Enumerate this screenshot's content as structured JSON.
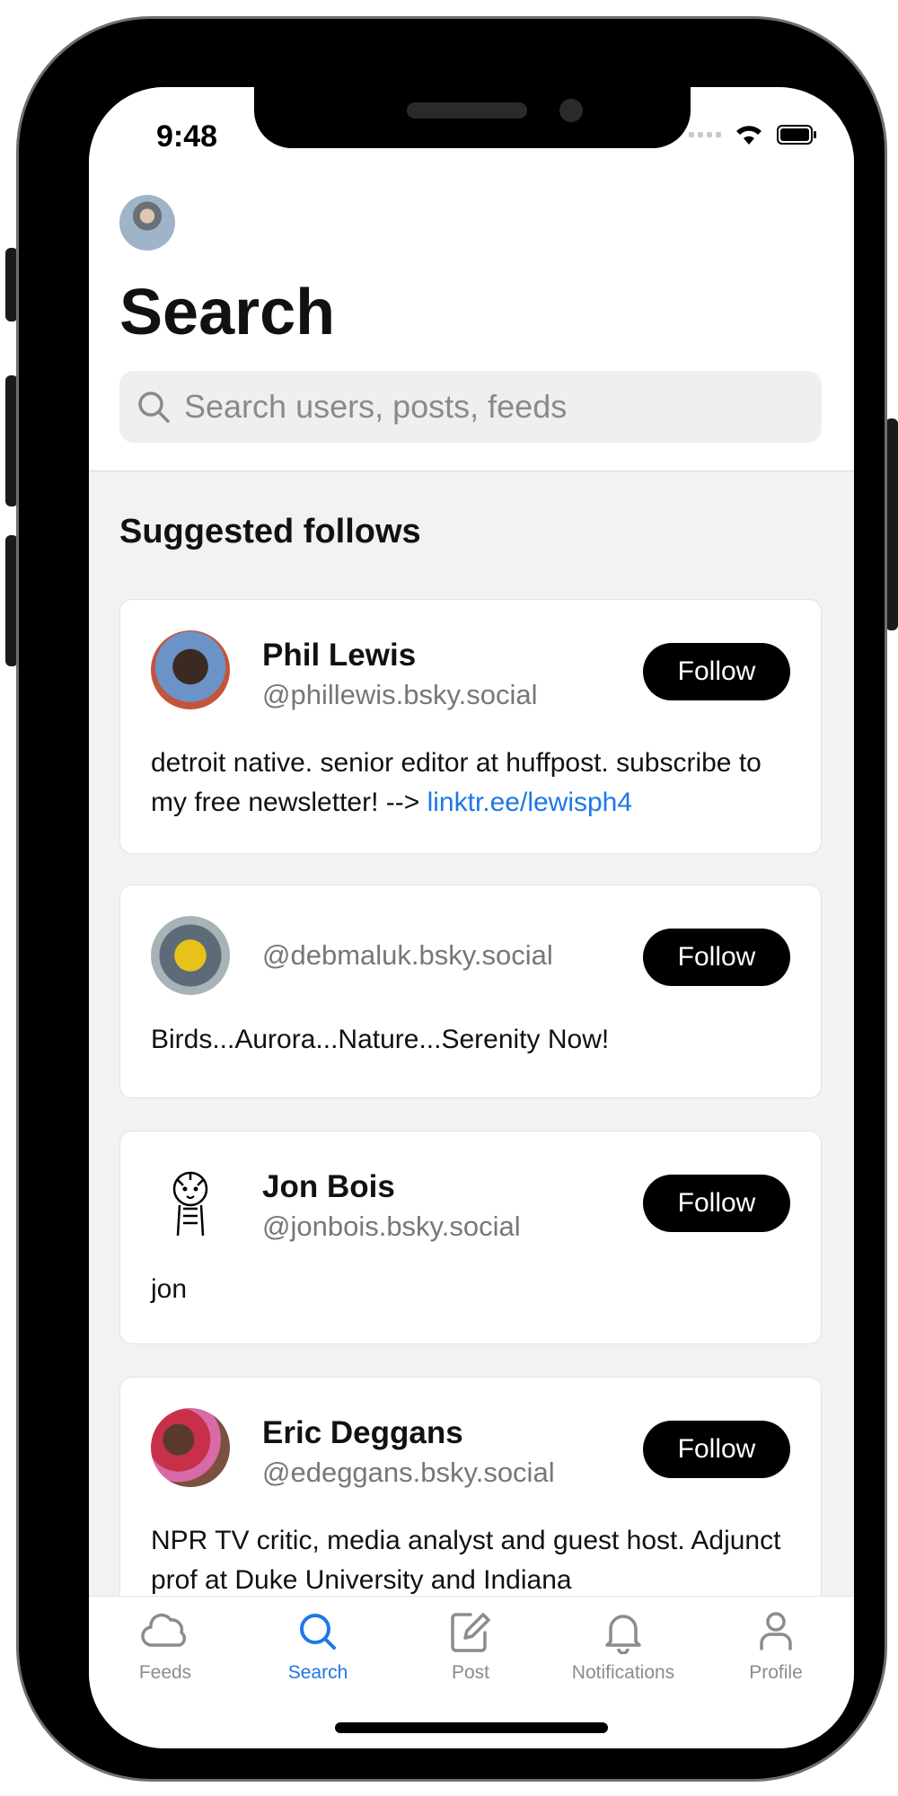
{
  "status": {
    "time": "9:48"
  },
  "header": {
    "title": "Search",
    "search_placeholder": "Search users, posts, feeds"
  },
  "section": {
    "title": "Suggested follows"
  },
  "suggestions": [
    {
      "name": "Phil Lewis",
      "handle": "@phillewis.bsky.social",
      "bio_text": "detroit native. senior editor at huffpost. subscribe to my free newsletter! --> ",
      "bio_link": "linktr.ee/lewisph4",
      "follow_label": "Follow"
    },
    {
      "name": "",
      "handle": "@debmaluk.bsky.social",
      "bio_text": "Birds...Aurora...Nature...Serenity Now!",
      "follow_label": "Follow"
    },
    {
      "name": "Jon Bois",
      "handle": "@jonbois.bsky.social",
      "bio_text": "jon",
      "follow_label": "Follow"
    },
    {
      "name": "Eric Deggans",
      "handle": "@edeggans.bsky.social",
      "bio_text": "NPR TV critic, media analyst and guest host. Adjunct prof at Duke University and Indiana",
      "follow_label": "Follow"
    }
  ],
  "tabs": [
    {
      "label": "Feeds",
      "icon": "cloud-icon",
      "active": false
    },
    {
      "label": "Search",
      "icon": "search-icon",
      "active": true
    },
    {
      "label": "Post",
      "icon": "compose-icon",
      "active": false
    },
    {
      "label": "Notifications",
      "icon": "bell-icon",
      "active": false
    },
    {
      "label": "Profile",
      "icon": "person-icon",
      "active": false
    }
  ],
  "colors": {
    "accent": "#1d77e8",
    "button_bg": "#000000",
    "content_bg": "#f2f2f2"
  }
}
